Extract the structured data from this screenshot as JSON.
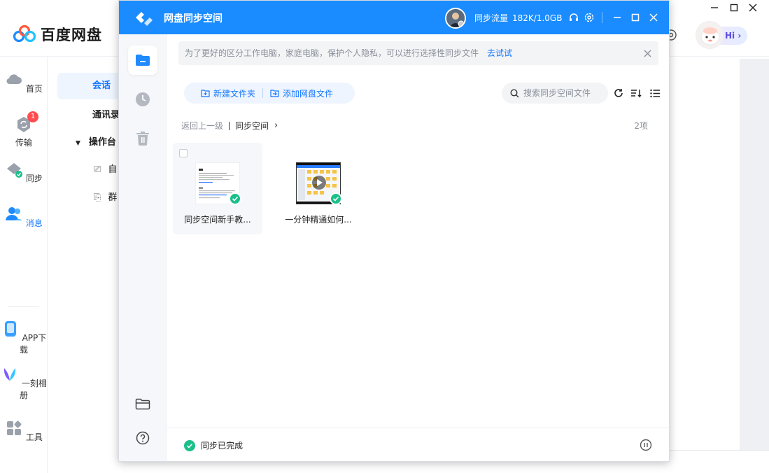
{
  "background_app": {
    "brand_title": "百度网盘",
    "hi_label": "Hi",
    "nav": [
      {
        "label": "首页",
        "icon": "cloud-icon"
      },
      {
        "label": "传输",
        "icon": "transfer-icon",
        "badge": "1"
      },
      {
        "label": "同步",
        "icon": "sync-icon"
      },
      {
        "label": "消息",
        "icon": "people-icon"
      },
      {
        "label": "APP下载",
        "icon": "phone-icon"
      },
      {
        "label": "一刻相册",
        "icon": "album-icon"
      },
      {
        "label": "工具",
        "icon": "tools-icon"
      }
    ],
    "sub_nav": [
      {
        "label": "会话"
      },
      {
        "label": "通讯录"
      },
      {
        "label": "操作台"
      },
      {
        "label": "自"
      },
      {
        "label": "群"
      }
    ]
  },
  "sync_window": {
    "title": "网盘同步空间",
    "traffic_label": "同步流量",
    "traffic_value": "182K/1.0GB",
    "notice_text": "为了更好的区分工作电脑，家庭电脑，保护个人隐私，可以进行选择性同步文件",
    "notice_link": "去试试",
    "new_folder_label": "新建文件夹",
    "add_file_label": "添加网盘文件",
    "search_placeholder": "搜索同步空间文件",
    "breadcrumb_back": "返回上一级",
    "breadcrumb_current": "同步空间",
    "item_count": "2项",
    "files": [
      {
        "name": "同步空间新手教...",
        "type": "document",
        "synced": true
      },
      {
        "name": "一分钟精通如何...",
        "type": "video",
        "synced": true
      }
    ],
    "status_text": "同步已完成"
  },
  "colors": {
    "primary": "#1a8cff",
    "accent_text": "#1677ff",
    "success": "#1bbf8a",
    "badge": "#ff4d4f"
  }
}
